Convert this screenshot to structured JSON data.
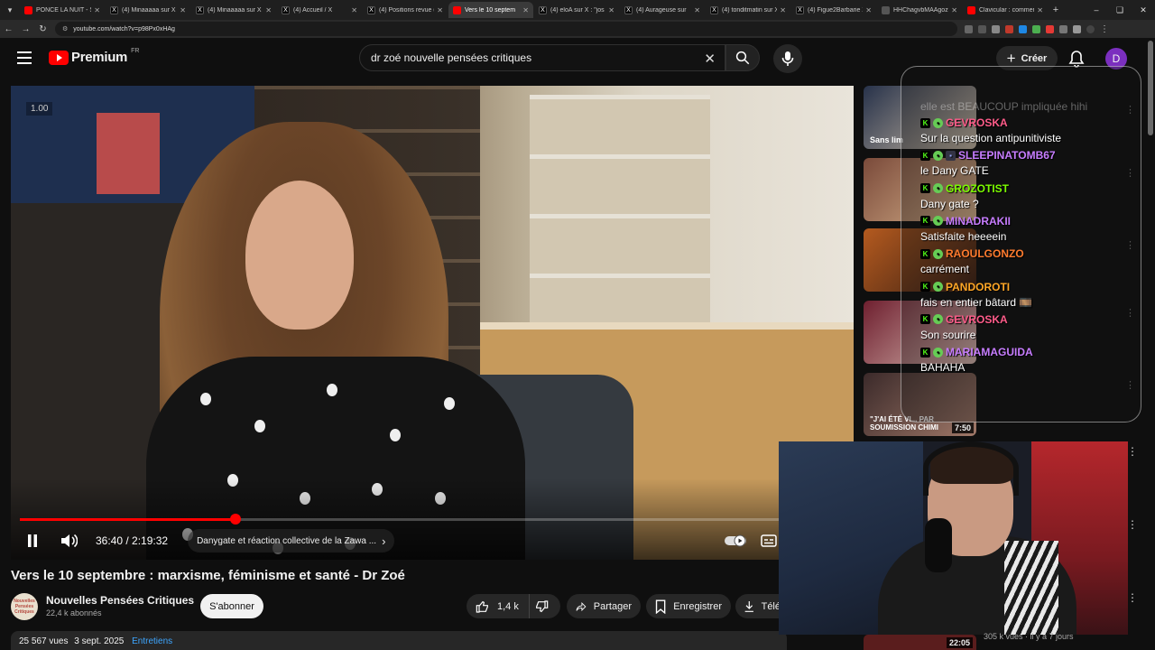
{
  "browser": {
    "tabs": [
      {
        "title": "PONCE LA NUIT - SAF",
        "favicon": "yt"
      },
      {
        "title": "(4) Minaaaaa sur X : \"s",
        "favicon": "x"
      },
      {
        "title": "(4) Minaaaaa sur X : \"c",
        "favicon": "x"
      },
      {
        "title": "(4) Accueil / X",
        "favicon": "x"
      },
      {
        "title": "(4) Positions revue (@",
        "favicon": "x"
      },
      {
        "title": "Vers le 10 septem",
        "favicon": "yt",
        "active": true
      },
      {
        "title": "(4) eloA sur X : \"jos re",
        "favicon": "x"
      },
      {
        "title": "(4) Aurageuse sur",
        "favicon": "x"
      },
      {
        "title": "(4) tonditmatin sur X : \"",
        "favicon": "x"
      },
      {
        "title": "(4) Figue2Barbarie X s",
        "favicon": "x"
      },
      {
        "title": "HHChagvbMAAgozc",
        "favicon": "other"
      },
      {
        "title": "Clavicular : comment",
        "favicon": "yt"
      }
    ],
    "url": "youtube.com/watch?v=p98Px0xHAg"
  },
  "header": {
    "logo_text": "Premium",
    "country_code": "FR",
    "search_query": "dr zoé nouvelle pensées critiques",
    "create_label": "Créer",
    "avatar_letter": "D"
  },
  "player": {
    "speed_badge": "1.00",
    "current_time": "36:40",
    "duration": "2:19:32",
    "time_display": "36:40 / 2:19:32",
    "progress_fraction": 0.262,
    "chapter": "Danygate et réaction collective de la Zawa ...",
    "chapter_arrow": "›"
  },
  "video": {
    "title": "Vers le 10 septembre : marxisme, féminisme et santé - Dr Zoé",
    "channel_name": "Nouvelles Pensées Critiques",
    "channel_avatar_text": "Nouvelles Pensées Critiques",
    "subscribers": "22,4 k abonnés",
    "subscribe_label": "S'abonner",
    "likes": "1,4 k",
    "share_label": "Partager",
    "save_label": "Enregistrer",
    "download_label": "Télé",
    "views": "25 567 vues",
    "date": "3 sept. 2025",
    "tag": "Entretiens"
  },
  "sidebar": {
    "recommendations": [
      {
        "caption": "Sans lim",
        "duration": ""
      },
      {
        "caption": "",
        "duration": ""
      },
      {
        "caption": "",
        "duration": ""
      },
      {
        "caption": "",
        "duration": ""
      },
      {
        "caption": "\"J'AI ÉTÉ VI... PAR SOUMISSION CHIMI",
        "duration": "7:50"
      }
    ],
    "bottom_duration": "22:05",
    "bottom_meta": "305 k vues · il y a 7 jours"
  },
  "chat": {
    "faded_line": "elle est BEAUCOUP impliquée hihi",
    "messages": [
      {
        "user": "GEVROSKA",
        "color": "#ff5c8a",
        "text": "Sur la question antipunitiviste"
      },
      {
        "user": "SLEEPINATOMB67",
        "color": "#c77dff",
        "text": "le Dany GATE"
      },
      {
        "user": "GROZOTIST",
        "color": "#7cfc00",
        "text": "Dany gate ?"
      },
      {
        "user": "MINADRAKII",
        "color": "#c77dff",
        "text": "Satisfaite heeeein"
      },
      {
        "user": "RAOULGONZO",
        "color": "#ff7b2e",
        "text": "carrément"
      },
      {
        "user": "PANDOROTI",
        "color": "#ffa726",
        "text": "fais en entier bâtard 🎞️"
      },
      {
        "user": "GEVROSKA",
        "color": "#ff5c8a",
        "text": "Son sourire"
      },
      {
        "user": "MARIAMAGUIDA",
        "color": "#c77dff",
        "text": "BAHAHA"
      }
    ]
  }
}
